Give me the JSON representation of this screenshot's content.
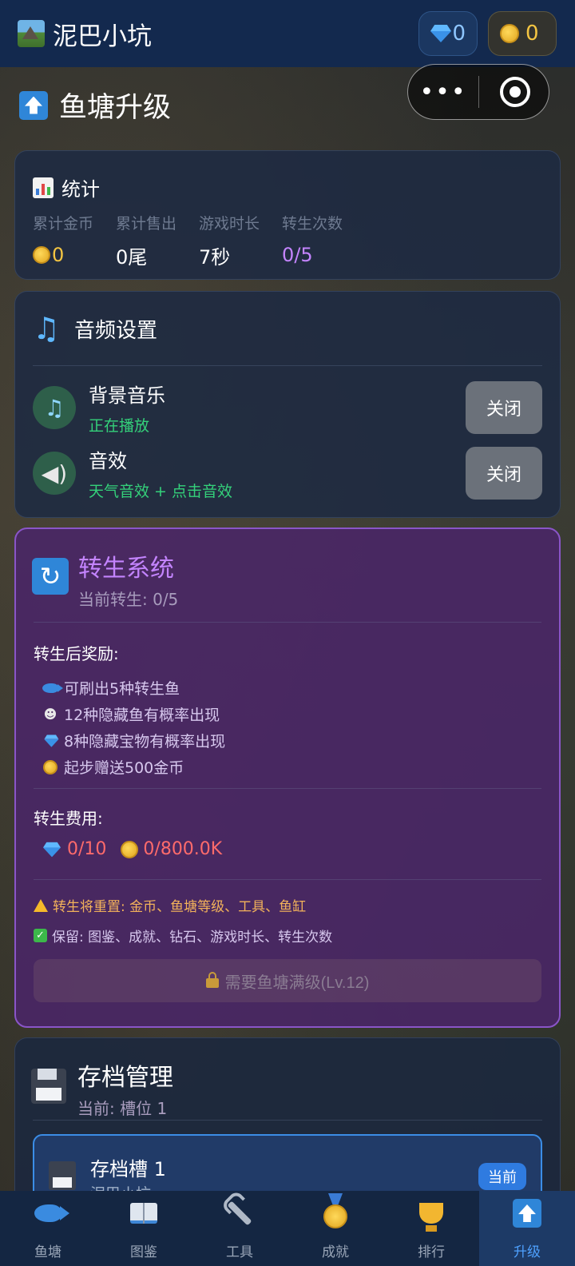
{
  "app": {
    "title": "泥巴小坑",
    "logo_icon": "landscape-icon"
  },
  "currency": {
    "gems": "0",
    "coins": "0"
  },
  "capsule": {
    "more_glyph": "•••"
  },
  "page": {
    "title": "鱼塘升级"
  },
  "stats": {
    "title": "统计",
    "items": [
      {
        "label": "累计金币",
        "value": "0"
      },
      {
        "label": "累计售出",
        "value": "0尾"
      },
      {
        "label": "游戏时长",
        "value": "7秒"
      },
      {
        "label": "转生次数",
        "value": "0/5"
      }
    ]
  },
  "audio": {
    "title": "音频设置",
    "bgm": {
      "name": "背景音乐",
      "status": "正在播放",
      "button": "关闭"
    },
    "sfx": {
      "name": "音效",
      "status": "天气音效 + 点击音效",
      "button": "关闭"
    }
  },
  "rebirth": {
    "title": "转生系统",
    "current": "当前转生: 0/5",
    "rewards_label": "转生后奖励:",
    "rewards": [
      "可刷出5种转生鱼",
      "12种隐藏鱼有概率出现",
      "8种隐藏宝物有概率出现",
      "起步赠送500金币"
    ],
    "cost_label": "转生费用:",
    "cost_gems": "0/10",
    "cost_coins": "0/800.0K",
    "warn": "转生将重置: 金币、鱼塘等级、工具、鱼缸",
    "keep": "保留: 图鉴、成就、钻石、游戏时长、转生次数",
    "button": "需要鱼塘满级(Lv.12)"
  },
  "save": {
    "title": "存档管理",
    "current": "当前: 槽位 1",
    "slot": {
      "title": "存档槽 1",
      "subtitle": "泥巴小坑",
      "badge": "当前"
    }
  },
  "colors": {
    "accent": "#4ea1ff",
    "rebirth": "#c484ff",
    "success": "#34d17a",
    "danger": "#ff6b6b"
  },
  "tabs": [
    {
      "label": "鱼塘",
      "icon": "fish-icon"
    },
    {
      "label": "图鉴",
      "icon": "book-icon"
    },
    {
      "label": "工具",
      "icon": "wrench-icon"
    },
    {
      "label": "成就",
      "icon": "medal-icon"
    },
    {
      "label": "排行",
      "icon": "trophy-icon"
    },
    {
      "label": "升级",
      "icon": "upgrade-icon"
    }
  ]
}
